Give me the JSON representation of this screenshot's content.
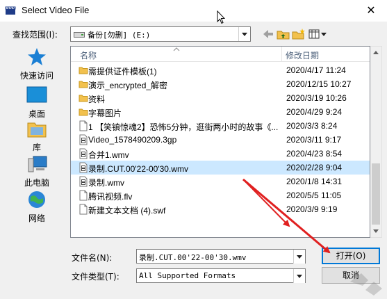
{
  "window": {
    "title": "Select Video File",
    "close_glyph": "✕"
  },
  "toolbar": {
    "lookin_label": "查找范围(I):",
    "lookin_value": "备份[勿删] (E:)",
    "icons": [
      "back-icon",
      "up-folder-icon",
      "new-folder-icon",
      "view-menu-icon"
    ]
  },
  "places": [
    {
      "name": "quick-access",
      "label": "快速访问",
      "icon": "star-icon"
    },
    {
      "name": "desktop",
      "label": "桌面",
      "icon": "desktop-icon"
    },
    {
      "name": "libraries",
      "label": "库",
      "icon": "library-icon"
    },
    {
      "name": "this-pc",
      "label": "此电脑",
      "icon": "computer-icon"
    },
    {
      "name": "network",
      "label": "网络",
      "icon": "network-icon"
    }
  ],
  "filelist": {
    "col_name": "名称",
    "col_date": "修改日期",
    "rows": [
      {
        "name": "需提供证件模板(1)",
        "date": "2020/4/17 11:24",
        "type": "folder",
        "selected": false
      },
      {
        "name": "演示_encrypted_解密",
        "date": "2020/12/15 10:27",
        "type": "folder",
        "selected": false
      },
      {
        "name": "资料",
        "date": "2020/3/19 10:26",
        "type": "folder",
        "selected": false
      },
      {
        "name": "字幕图片",
        "date": "2020/4/29 9:24",
        "type": "folder",
        "selected": false
      },
      {
        "name": "1 【笑镇惊魂2】恐怖5分钟，逛街两小时的故事《...",
        "date": "2020/3/3 8:24",
        "type": "file",
        "selected": false
      },
      {
        "name": "Video_1578490209.3gp",
        "date": "2020/3/11 9:17",
        "type": "video",
        "selected": false
      },
      {
        "name": "合并1.wmv",
        "date": "2020/4/23 8:54",
        "type": "video",
        "selected": false
      },
      {
        "name": "录制.CUT.00'22-00'30.wmv",
        "date": "2020/2/28 9:04",
        "type": "video",
        "selected": true
      },
      {
        "name": "录制.wmv",
        "date": "2020/1/8 14:31",
        "type": "video",
        "selected": false
      },
      {
        "name": "腾讯视频.flv",
        "date": "2020/5/5 11:05",
        "type": "file",
        "selected": false
      },
      {
        "name": "新建文本文档 (4).swf",
        "date": "2020/3/9 9:19",
        "type": "file",
        "selected": false
      }
    ]
  },
  "footer": {
    "filename_label": "文件名(N):",
    "filename_value": "录制.CUT.00'22-00'30.wmv",
    "filetype_label": "文件类型(T):",
    "filetype_value": "All Supported Formats",
    "open_label": "打开(O)",
    "cancel_label": "取消"
  },
  "colors": {
    "selection": "#cce8ff",
    "arrow": "#e02020",
    "accent": "#0078d7",
    "folder": "#f2c14e"
  }
}
